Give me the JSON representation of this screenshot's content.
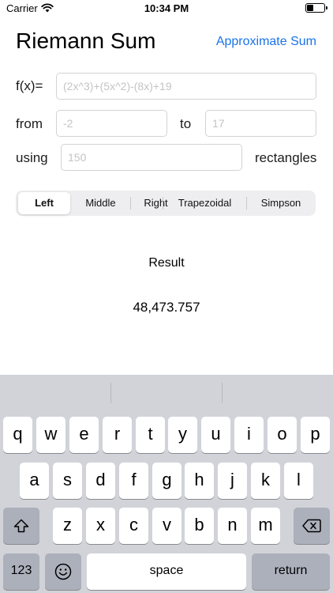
{
  "status_bar": {
    "carrier": "Carrier",
    "time": "10:34 PM",
    "battery_level": 0.4
  },
  "header": {
    "title": "Riemann Sum",
    "approximate_button": "Approximate Sum"
  },
  "form": {
    "fx_label": "f(x)=",
    "fx_placeholder": "(2x^3)+(5x^2)-(8x)+19",
    "from_label": "from",
    "from_placeholder": "-2",
    "to_label": "to",
    "to_placeholder": "17",
    "using_label": "using",
    "rect_placeholder": "150",
    "rect_label": "rectangles"
  },
  "methods": {
    "items": [
      "Left",
      "Middle",
      "Right",
      "Trapezoidal",
      "Simpson"
    ],
    "selected": "Left"
  },
  "result": {
    "label": "Result",
    "value": "48,473.757"
  },
  "keyboard": {
    "row1": [
      "q",
      "w",
      "e",
      "r",
      "t",
      "y",
      "u",
      "i",
      "o",
      "p"
    ],
    "row2": [
      "a",
      "s",
      "d",
      "f",
      "g",
      "h",
      "j",
      "k",
      "l"
    ],
    "row3": [
      "z",
      "x",
      "c",
      "v",
      "b",
      "n",
      "m"
    ],
    "numbers_key": "123",
    "space_key": "space",
    "return_key": "return",
    "shift_icon": "shift-icon",
    "delete_icon": "delete-icon",
    "emoji_icon": "emoji-icon"
  },
  "colors": {
    "accent": "#1a73e8",
    "keyboard_bg": "#d1d3d9",
    "key_dark": "#abb0bb"
  }
}
